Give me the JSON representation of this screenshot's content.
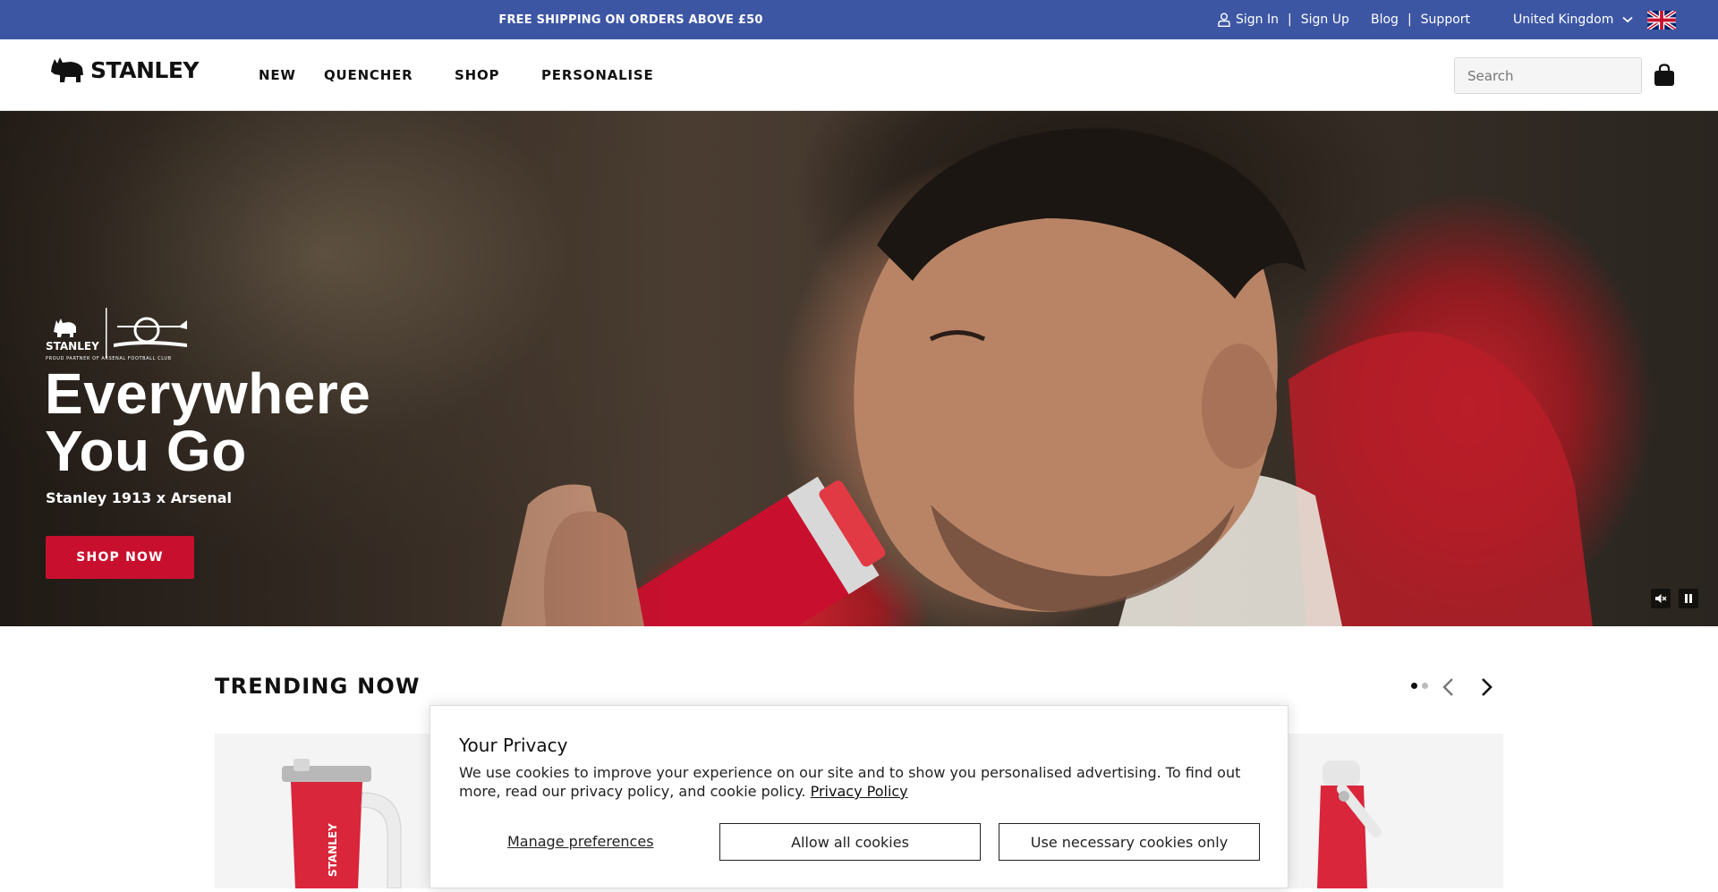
{
  "announcement": {
    "promo": "FREE SHIPPING ON ORDERS ABOVE £50",
    "sign_in": "Sign In",
    "divider": "|",
    "sign_up": "Sign Up",
    "blog": "Blog",
    "support": "Support",
    "region": "United Kingdom",
    "bar_color": "#3d56a4"
  },
  "header": {
    "brand": "STANLEY",
    "nav": [
      "NEW",
      "QUENCHER",
      "SHOP",
      "PERSONALISE"
    ],
    "search_placeholder": "Search"
  },
  "hero": {
    "partner_caption": "PROUD PARTNER OF ARSENAL FOOTBALL CLUB",
    "partner_brand": "STANLEY",
    "title_line1": "Everywhere",
    "title_line2": "You Go",
    "subtitle": "Stanley 1913 x Arsenal",
    "cta": "SHOP NOW",
    "cta_color": "#c8102e"
  },
  "trending": {
    "title": "TRENDING NOW",
    "product_brand": "STANLEY"
  },
  "cookie": {
    "title": "Your Privacy",
    "body": "We use cookies to improve your experience on our site and to show you personalised advertising. To find out more, read our privacy policy, and cookie policy.",
    "policy_link": "Privacy Policy",
    "manage": "Manage preferences",
    "allow_all": "Allow all cookies",
    "necessary_only": "Use necessary cookies only"
  }
}
